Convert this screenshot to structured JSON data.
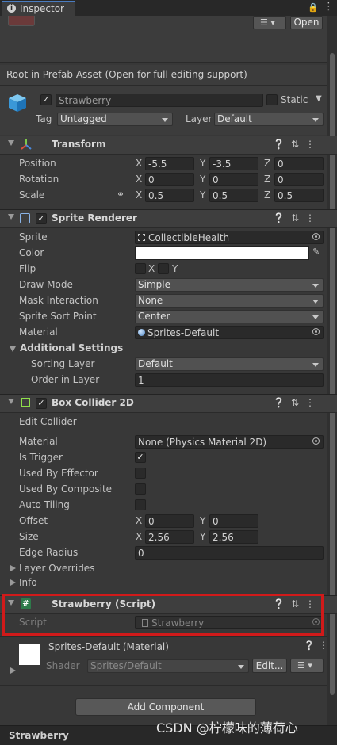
{
  "window": {
    "tab_title": "Inspector",
    "open_button": "Open"
  },
  "prefab_banner": "Root in Prefab Asset (Open for full editing support)",
  "object": {
    "name": "Strawberry",
    "static_label": "Static",
    "tag_label": "Tag",
    "tag_value": "Untagged",
    "layer_label": "Layer",
    "layer_value": "Default"
  },
  "transform": {
    "title": "Transform",
    "position_label": "Position",
    "rotation_label": "Rotation",
    "scale_label": "Scale",
    "position": {
      "x": "-5.5",
      "y": "-3.5",
      "z": "0"
    },
    "rotation": {
      "x": "0",
      "y": "0",
      "z": "0"
    },
    "scale": {
      "x": "0.5",
      "y": "0.5",
      "z": "0.5"
    }
  },
  "axes": {
    "x": "X",
    "y": "Y",
    "z": "Z"
  },
  "sprite_renderer": {
    "title": "Sprite Renderer",
    "sprite_label": "Sprite",
    "sprite_value": "CollectibleHealth",
    "color_label": "Color",
    "color_value": "#ffffff",
    "flip_label": "Flip",
    "flip_x": "X",
    "flip_y": "Y",
    "draw_mode_label": "Draw Mode",
    "draw_mode_value": "Simple",
    "mask_label": "Mask Interaction",
    "mask_value": "None",
    "sort_point_label": "Sprite Sort Point",
    "sort_point_value": "Center",
    "material_label": "Material",
    "material_value": "Sprites-Default",
    "additional_label": "Additional Settings",
    "sorting_layer_label": "Sorting Layer",
    "sorting_layer_value": "Default",
    "order_label": "Order in Layer",
    "order_value": "1"
  },
  "box_collider": {
    "title": "Box Collider 2D",
    "edit_label": "Edit Collider",
    "material_label": "Material",
    "material_value": "None (Physics Material 2D)",
    "is_trigger_label": "Is Trigger",
    "is_trigger": true,
    "effector_label": "Used By Effector",
    "composite_label": "Used By Composite",
    "auto_tiling_label": "Auto Tiling",
    "offset_label": "Offset",
    "offset": {
      "x": "0",
      "y": "0"
    },
    "size_label": "Size",
    "size": {
      "x": "2.56",
      "y": "2.56"
    },
    "edge_radius_label": "Edge Radius",
    "edge_radius_value": "0",
    "layer_overrides_label": "Layer Overrides",
    "info_label": "Info"
  },
  "script_component": {
    "title": "Strawberry (Script)",
    "script_label": "Script",
    "script_value": "Strawberry",
    "highlight_color": "#d11a1a"
  },
  "material_section": {
    "title": "Sprites-Default (Material)",
    "shader_label": "Shader",
    "shader_value": "Sprites/Default",
    "edit_button": "Edit..."
  },
  "add_component": "Add Component",
  "footer": {
    "name": "Strawberry"
  },
  "watermark": "CSDN @柠檬味的薄荷心"
}
